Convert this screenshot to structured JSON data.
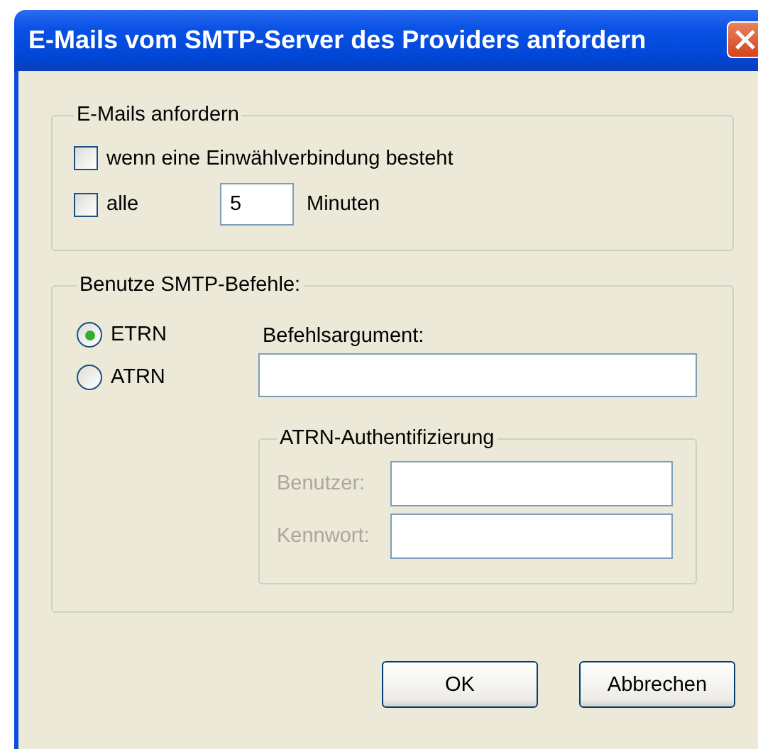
{
  "window": {
    "title": "E-Mails vom SMTP-Server des Providers anfordern"
  },
  "fetch_group": {
    "legend": "E-Mails anfordern",
    "dialup": {
      "label": "wenn eine Einwählverbindung besteht",
      "checked": false
    },
    "interval": {
      "label": "alle",
      "checked": false,
      "value": "5",
      "unit": "Minuten"
    }
  },
  "smtp_group": {
    "legend": "Benutze SMTP-Befehle:",
    "commands": [
      {
        "label": "ETRN",
        "selected": true
      },
      {
        "label": "ATRN",
        "selected": false
      }
    ],
    "argument": {
      "label": "Befehlsargument:"
    },
    "auth_group": {
      "legend": "ATRN-Authentifizierung",
      "fields": [
        {
          "label": "Benutzer:",
          "disabled": true
        },
        {
          "label": "Kennwort:",
          "disabled": true
        }
      ]
    }
  },
  "buttons": [
    "OK",
    "Abbrechen"
  ]
}
